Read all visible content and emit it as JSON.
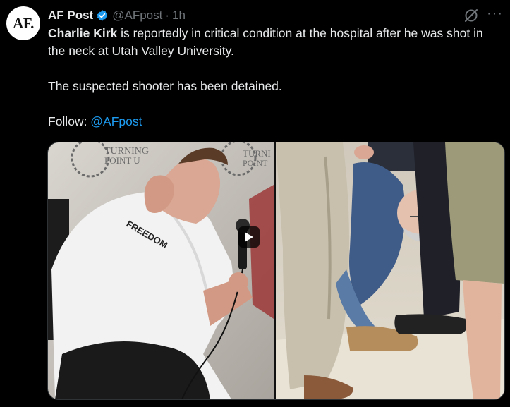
{
  "author": {
    "avatar_text": "AF.",
    "name": "AF Post",
    "handle": "@AFpost",
    "separator": "·",
    "time": "1h"
  },
  "post": {
    "bold_name": "Charlie Kirk",
    "line1_rest": " is reportedly in critical condition at the hospital after he was shot in the neck at Utah Valley University.",
    "line2": "The suspected shooter has been detained.",
    "follow_label": "Follow: ",
    "follow_link": "@AFpost"
  },
  "media": {
    "left_image": {
      "backdrop_text_1": "TURNING",
      "backdrop_text_1b": "POINT U",
      "backdrop_text_2": "TURNI",
      "backdrop_text_2b": "POINT",
      "shirt_text": "FREEDOM"
    }
  },
  "icons": {
    "verified": "verified-badge-icon",
    "grok": "grok-icon",
    "more": "more-icon",
    "play": "play-icon"
  },
  "colors": {
    "background": "#000000",
    "text": "#e7e9ea",
    "muted": "#71767b",
    "link": "#1d9bf0"
  }
}
